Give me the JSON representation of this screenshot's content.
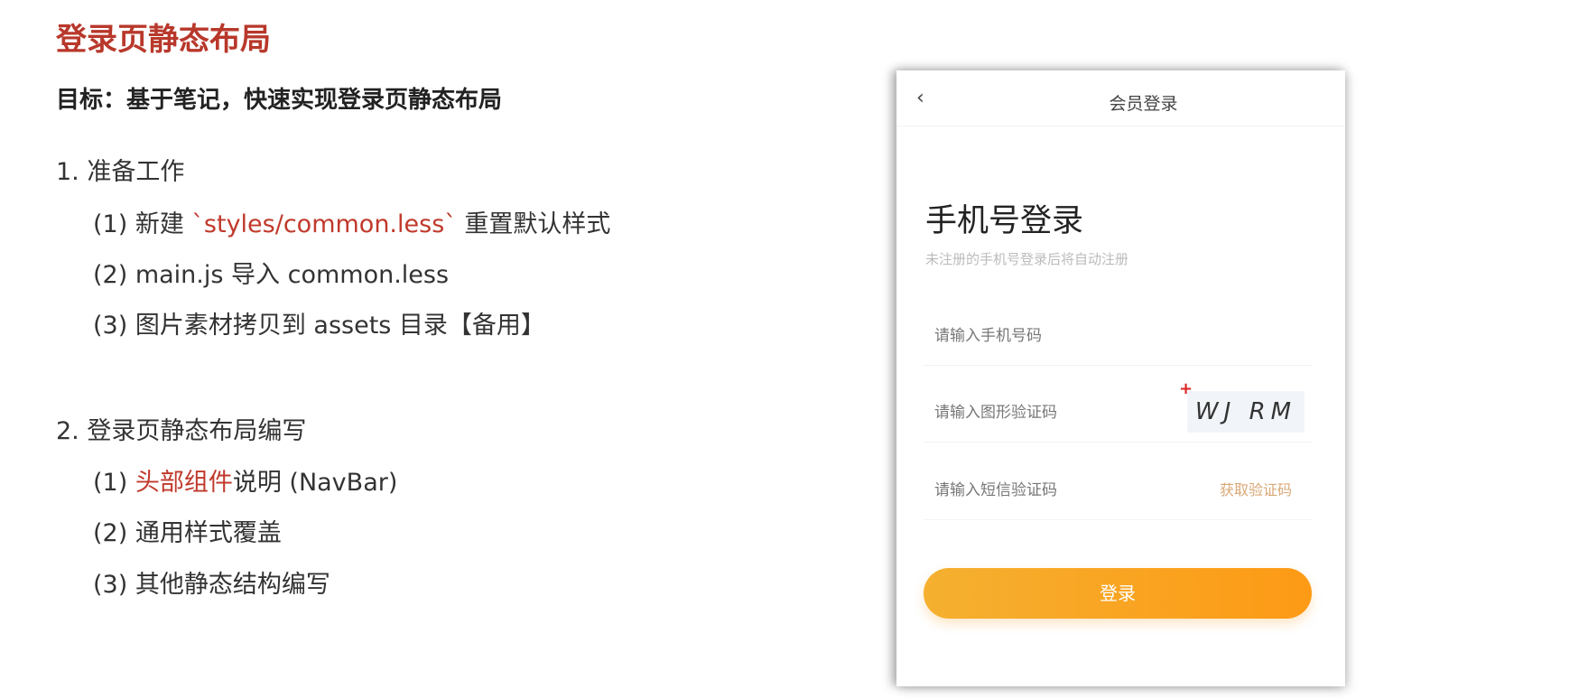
{
  "slide": {
    "title": "登录页静态布局",
    "goal": "目标：基于笔记，快速实现登录页静态布局",
    "sections": [
      {
        "heading": "1. 准备工作",
        "items": [
          {
            "prefix": "(1) 新建 ",
            "highlight": "`styles/common.less`",
            "suffix": " 重置默认样式"
          },
          {
            "prefix": "(2) main.js 导入 common.less"
          },
          {
            "prefix": "(3) 图片素材拷贝到 assets 目录【备用】"
          }
        ]
      },
      {
        "heading": "2. 登录页静态布局编写",
        "items": [
          {
            "prefix": "(1) ",
            "highlight": "头部组件",
            "suffix": "说明 (NavBar)"
          },
          {
            "prefix": "(2) 通用样式覆盖"
          },
          {
            "prefix": "(3) 其他静态结构编写"
          }
        ]
      }
    ]
  },
  "phone": {
    "nav_back": "‹",
    "nav_title": "会员登录",
    "heading": "手机号登录",
    "subtitle": "未注册的手机号登录后将自动注册",
    "phone_placeholder": "请输入手机号码",
    "captcha_placeholder": "请输入图形验证码",
    "captcha_text": "WJ RM",
    "sms_placeholder": "请输入短信验证码",
    "get_code": "获取验证码",
    "login_button": "登录",
    "accent": "#fd9a15"
  }
}
